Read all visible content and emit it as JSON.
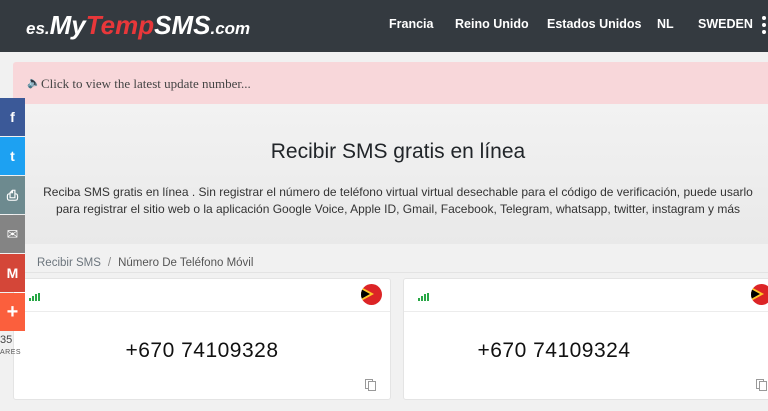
{
  "logo": {
    "prefix": "es.",
    "my": "My",
    "temp": "Temp",
    "sms": "SMS",
    "suffix": ".com"
  },
  "nav": {
    "items": [
      "Francia",
      "Reino Unido",
      "Estados Unidos",
      "NL",
      "SWEDEN"
    ]
  },
  "alert": {
    "text": "Click to view the latest update number...",
    "icon": "speaker-icon"
  },
  "hero": {
    "title": "Recibir SMS gratis en línea",
    "description": "Reciba SMS gratis en línea . Sin registrar el número de teléfono virtual virtual desechable para el código de verificación, puede usarlo para registrar el sitio web o la aplicación Google Voice, Apple ID, Gmail, Facebook, Telegram, whatsapp, twitter, instagram y más"
  },
  "breadcrumb": {
    "home": "Recibir SMS",
    "separator": "/",
    "current": "Número De Teléfono Móvil"
  },
  "cards": [
    {
      "number": "+670 74109328",
      "flag": "timor-leste-flag-icon"
    },
    {
      "number": "+670 74109324",
      "flag": "timor-leste-flag-icon"
    }
  ],
  "share": {
    "buttons": [
      {
        "icon": "facebook-icon",
        "glyph": "f",
        "color": "#3b5998"
      },
      {
        "icon": "twitter-icon",
        "glyph": "t",
        "color": "#1da1f2"
      },
      {
        "icon": "print-icon",
        "glyph": "⎙",
        "color": "#6d8a8f"
      },
      {
        "icon": "email-icon",
        "glyph": "✉",
        "color": "#848484"
      },
      {
        "icon": "gmail-icon",
        "glyph": "M",
        "color": "#d44638"
      },
      {
        "icon": "more-icon",
        "glyph": "+",
        "color": "#fb5f3d"
      }
    ],
    "count": "35",
    "label": "ARES"
  },
  "colors": {
    "topbar": "#343a40",
    "accent": "#e8373a",
    "alert_bg": "#f8d7da",
    "signal": "#28a745"
  }
}
